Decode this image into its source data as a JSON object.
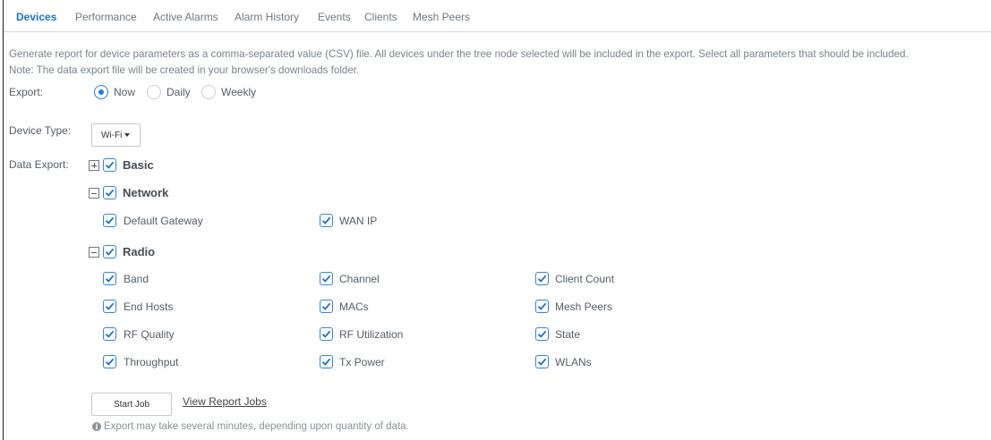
{
  "tabs": [
    {
      "label": "Devices",
      "active": true
    },
    {
      "label": "Performance",
      "active": false
    },
    {
      "label": "Active Alarms",
      "active": false
    },
    {
      "label": "Alarm History",
      "active": false
    },
    {
      "label": "Events",
      "active": false
    },
    {
      "label": "Clients",
      "active": false
    },
    {
      "label": "Mesh Peers",
      "active": false
    }
  ],
  "description": {
    "line1": "Generate report for device parameters as a comma-separated value (CSV) file. All devices under the tree node selected will be included in the export. Select all parameters that should be included.",
    "line2": "Note: The data export file will be created in your browser's downloads folder."
  },
  "export": {
    "label": "Export:",
    "options": [
      {
        "label": "Now",
        "selected": true
      },
      {
        "label": "Daily",
        "selected": false
      },
      {
        "label": "Weekly",
        "selected": false
      }
    ]
  },
  "device_type": {
    "label": "Device Type:",
    "value": "Wi-Fi"
  },
  "data_export": {
    "label": "Data Export:",
    "groups": [
      {
        "label": "Basic",
        "checked": true,
        "expanded": false,
        "items": []
      },
      {
        "label": "Network",
        "checked": true,
        "expanded": true,
        "items": [
          {
            "label": "Default Gateway",
            "checked": true
          },
          {
            "label": "WAN IP",
            "checked": true
          }
        ]
      },
      {
        "label": "Radio",
        "checked": true,
        "expanded": true,
        "items": [
          {
            "label": "Band",
            "checked": true
          },
          {
            "label": "Channel",
            "checked": true
          },
          {
            "label": "Client Count",
            "checked": true
          },
          {
            "label": "End Hosts",
            "checked": true
          },
          {
            "label": "MACs",
            "checked": true
          },
          {
            "label": "Mesh Peers",
            "checked": true
          },
          {
            "label": "RF Quality",
            "checked": true
          },
          {
            "label": "RF Utilization",
            "checked": true
          },
          {
            "label": "State",
            "checked": true
          },
          {
            "label": "Throughput",
            "checked": true
          },
          {
            "label": "Tx Power",
            "checked": true
          },
          {
            "label": "WLANs",
            "checked": true
          }
        ]
      }
    ]
  },
  "actions": {
    "start_job": "Start Job",
    "view_report_jobs": "View Report Jobs",
    "hint": "Export may take several minutes, depending upon quantity of data."
  },
  "colors": {
    "accent": "#1a73c8",
    "checkbox_border": "#2f86d6",
    "checkmark": "#1d6fc4"
  }
}
